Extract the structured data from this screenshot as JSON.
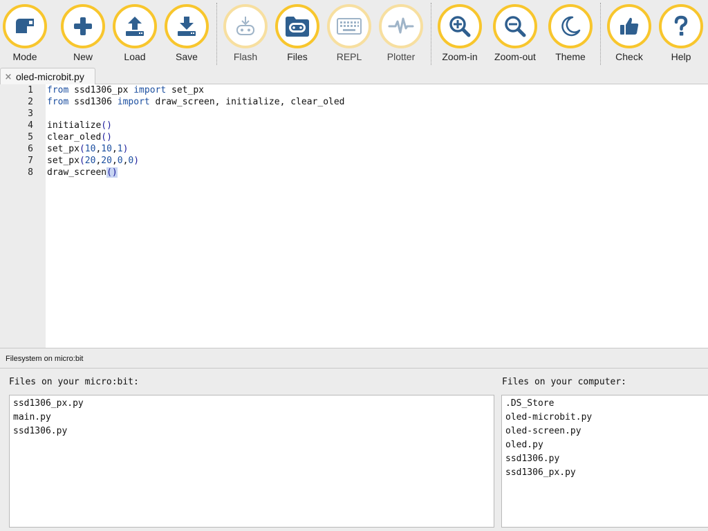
{
  "toolbar": {
    "buttons": [
      {
        "label": "Mode",
        "icon": "mode-icon"
      },
      {
        "label": "New",
        "icon": "plus-icon"
      },
      {
        "label": "Load",
        "icon": "upload-icon"
      },
      {
        "label": "Save",
        "icon": "download-icon"
      },
      {
        "label": "Flash",
        "icon": "flash-icon",
        "disabled": true
      },
      {
        "label": "Files",
        "icon": "files-icon"
      },
      {
        "label": "REPL",
        "icon": "keyboard-icon",
        "disabled": true
      },
      {
        "label": "Plotter",
        "icon": "pulse-icon",
        "disabled": true
      },
      {
        "label": "Zoom-in",
        "icon": "zoom-in-icon"
      },
      {
        "label": "Zoom-out",
        "icon": "zoom-out-icon"
      },
      {
        "label": "Theme",
        "icon": "moon-icon"
      },
      {
        "label": "Check",
        "icon": "thumbs-up-icon"
      },
      {
        "label": "Help",
        "icon": "question-icon"
      }
    ]
  },
  "tabs": [
    {
      "label": "oled-microbit.py",
      "close": "×"
    }
  ],
  "editor": {
    "line_numbers": [
      "1",
      "2",
      "3",
      "4",
      "5",
      "6",
      "7",
      "8"
    ],
    "lines": [
      "from ssd1306_px import set_px",
      "from ssd1306 import draw_screen, initialize, clear_oled",
      "",
      "initialize()",
      "clear_oled()",
      "set_px(10,10,1)",
      "set_px(20,20,0,0)",
      "draw_screen()"
    ]
  },
  "filesystem": {
    "title": "Filesystem on micro:bit",
    "microbit_label": "Files on your micro:bit:",
    "microbit_files": [
      "ssd1306_px.py",
      "main.py",
      "ssd1306.py"
    ],
    "computer_label": "Files on your computer:",
    "computer_files": [
      ".DS_Store",
      "oled-microbit.py",
      "oled-screen.py",
      "oled.py",
      "ssd1306.py",
      "ssd1306_px.py"
    ]
  },
  "colors": {
    "icon_blue": "#2f5f8f",
    "icon_disabled": "#9fb4c8",
    "ring_yellow": "#f8c62d",
    "keyword": "#1c4fa0"
  }
}
